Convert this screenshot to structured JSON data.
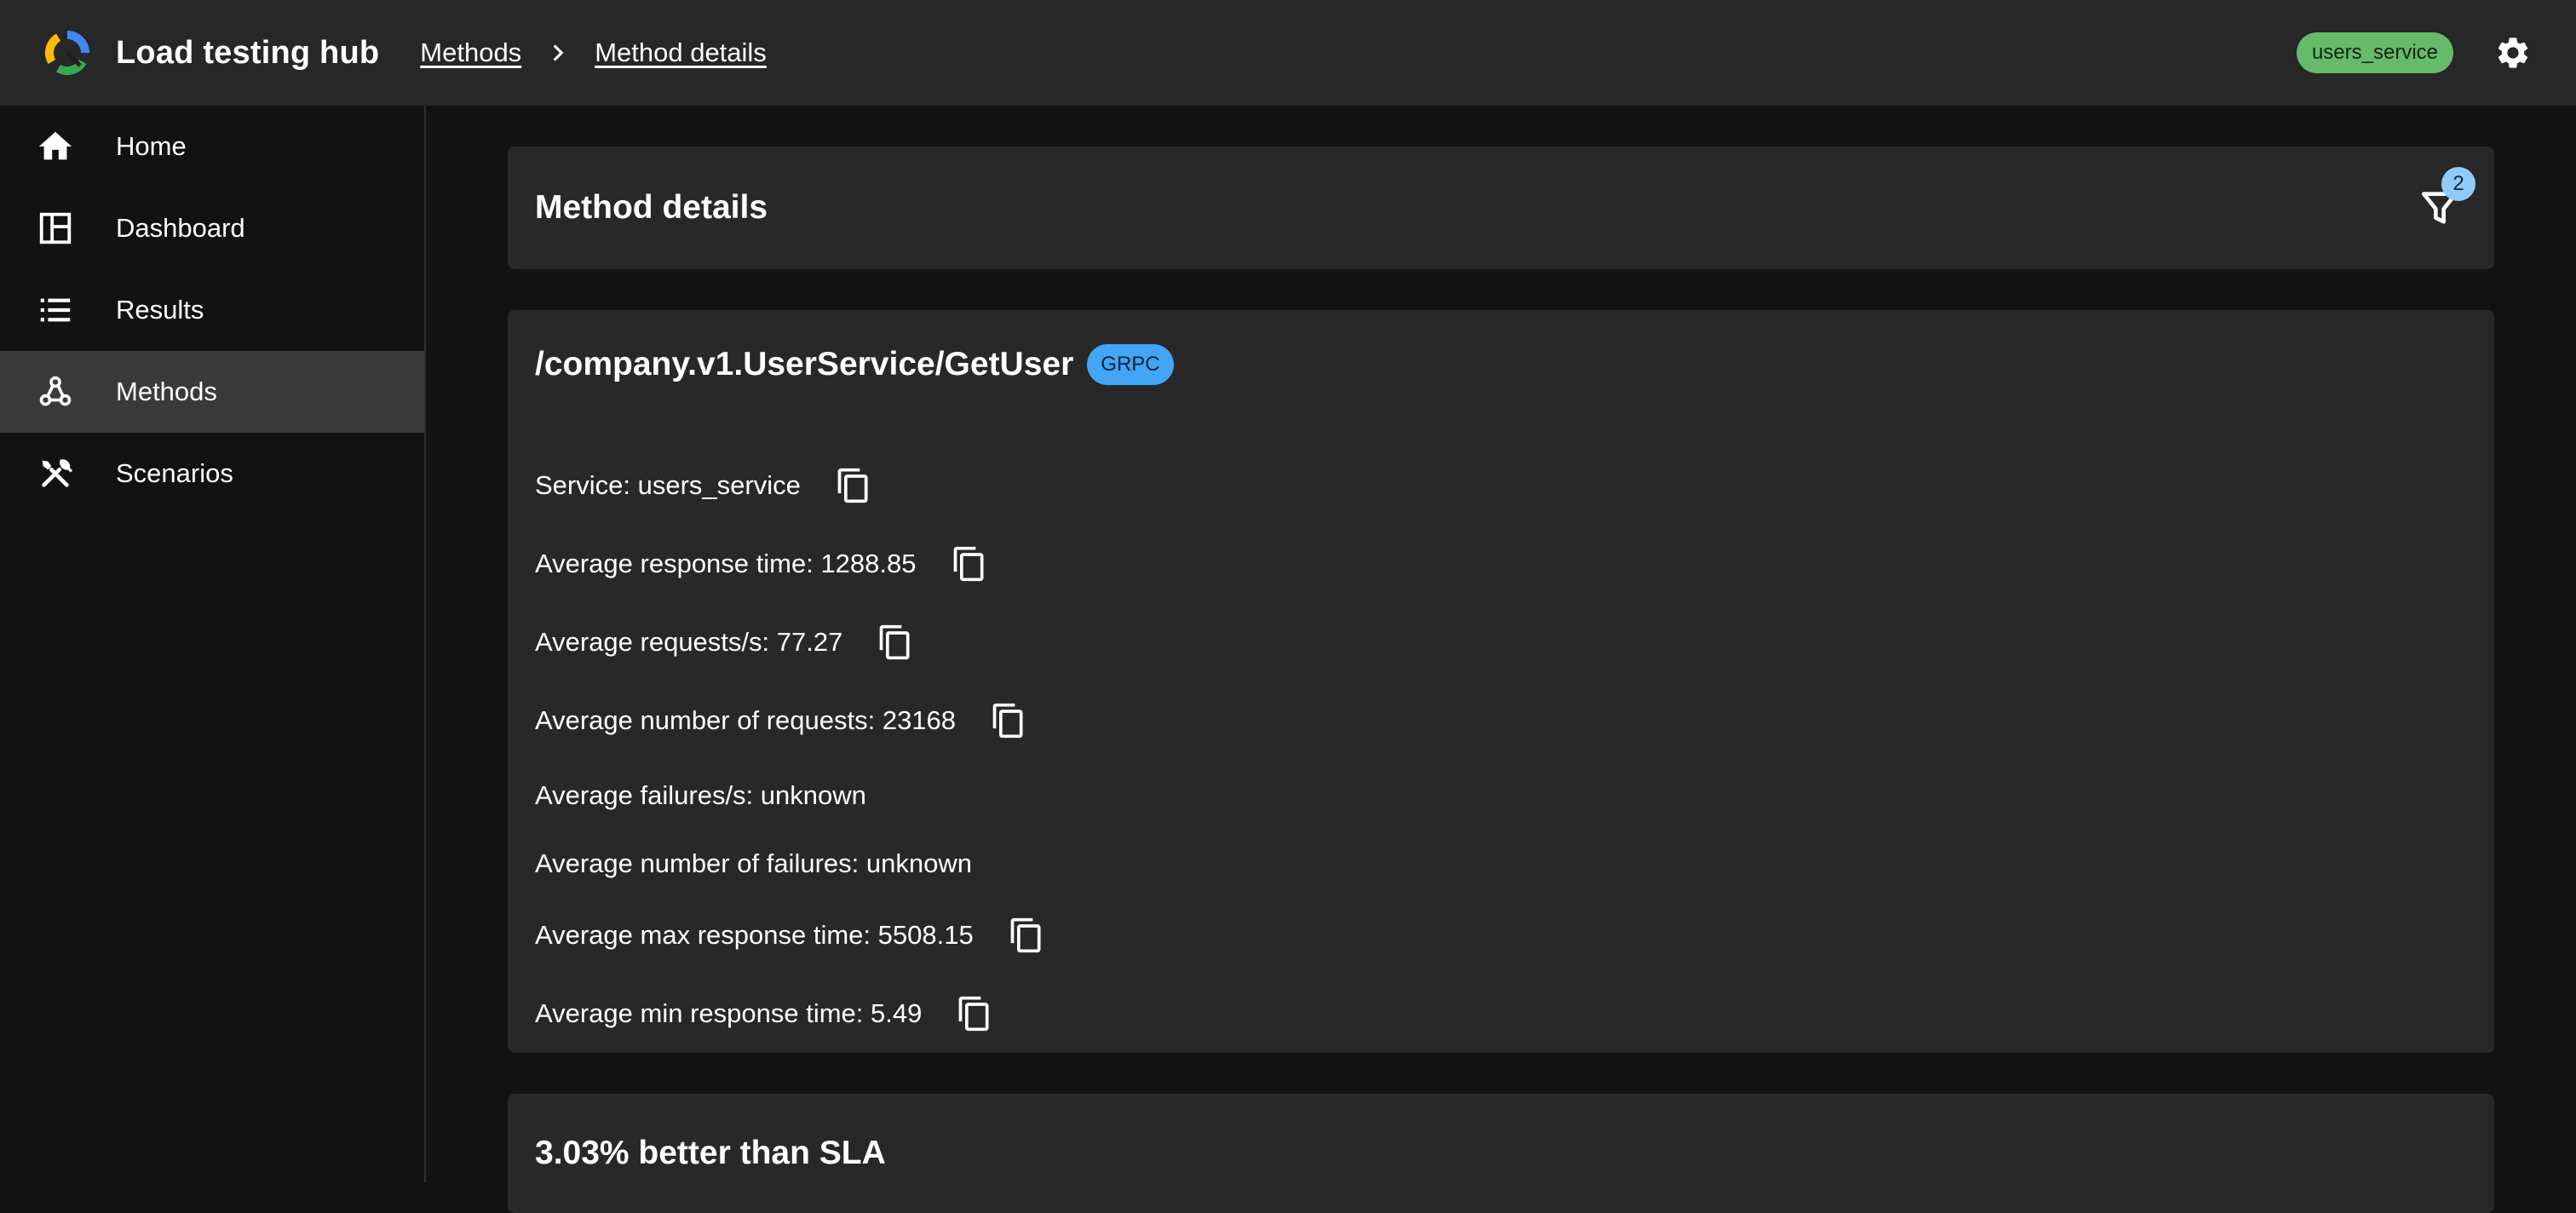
{
  "app": {
    "title": "Load testing hub"
  },
  "breadcrumb": [
    {
      "label": "Methods"
    },
    {
      "label": "Method details"
    }
  ],
  "header": {
    "service_chip": "users_service"
  },
  "sidebar": {
    "items": [
      {
        "label": "Home",
        "icon": "home-icon"
      },
      {
        "label": "Dashboard",
        "icon": "dashboard-icon"
      },
      {
        "label": "Results",
        "icon": "list-icon"
      },
      {
        "label": "Methods",
        "icon": "webhook-icon",
        "active": true
      },
      {
        "label": "Scenarios",
        "icon": "tools-icon"
      }
    ]
  },
  "page": {
    "title": "Method details",
    "filter_count": "2"
  },
  "method": {
    "name": "/company.v1.UserService/GetUser",
    "protocol": "GRPC",
    "stats": [
      {
        "label": "Service: users_service",
        "copy": true
      },
      {
        "label": "Average response time: 1288.85",
        "copy": true
      },
      {
        "label": "Average requests/s: 77.27",
        "copy": true
      },
      {
        "label": "Average number of requests: 23168",
        "copy": true
      },
      {
        "label": "Average failures/s: unknown",
        "copy": false
      },
      {
        "label": "Average number of failures: unknown",
        "copy": false
      },
      {
        "label": "Average max response time: 5508.15",
        "copy": true
      },
      {
        "label": "Average min response time: 5.49",
        "copy": true
      }
    ]
  },
  "sla": {
    "title": "3.03% better than SLA"
  },
  "colors": {
    "appbar": "#272727",
    "background": "#121212",
    "card": "#282828",
    "service_chip": "#66bb6a",
    "grpc_chip": "#42a5f5",
    "badge": "#90caf9"
  }
}
